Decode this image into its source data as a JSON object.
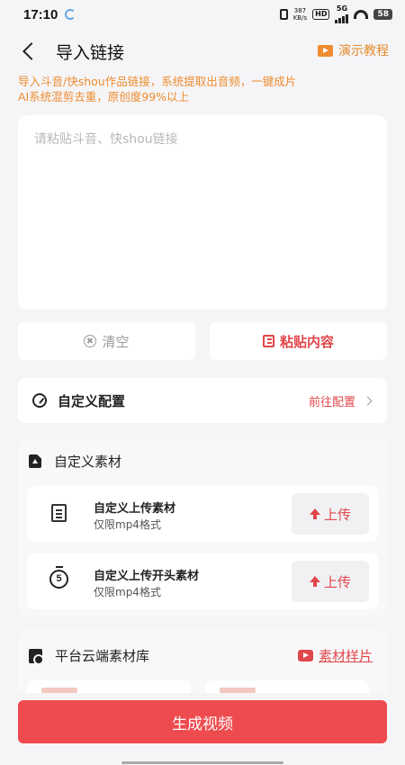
{
  "status_bar": {
    "time": "17:10",
    "speed_value": "387",
    "speed_unit": "KB/s",
    "hd": "HD",
    "network": "5G",
    "battery": "58"
  },
  "header": {
    "title": "导入链接",
    "demo_label": "演示教程"
  },
  "notice": {
    "line1": "导入斗音/快shou作品链接，系统提取出音频，一键成片",
    "line2": "AI系统混剪去重，原创度99%以上"
  },
  "link_input": {
    "placeholder": "请粘贴斗音、快shou链接",
    "value": ""
  },
  "actions": {
    "clear_label": "清空",
    "paste_label": "粘贴内容"
  },
  "config": {
    "label": "自定义配置",
    "go_label": "前往配置"
  },
  "custom_material": {
    "title": "自定义素材",
    "items": [
      {
        "title": "自定义上传素材",
        "subtitle": "仅限mp4格式",
        "button": "上传"
      },
      {
        "title": "自定义上传开头素材",
        "subtitle": "仅限mp4格式",
        "button": "上传",
        "icon_text": "5"
      }
    ]
  },
  "cloud_library": {
    "title": "平台云端素材库",
    "sample_label": "素材样片"
  },
  "footer": {
    "generate_label": "生成视频"
  },
  "colors": {
    "accent_red": "#e0474c",
    "accent_orange": "#ee8c2f",
    "primary_button": "#ee4b4f"
  }
}
